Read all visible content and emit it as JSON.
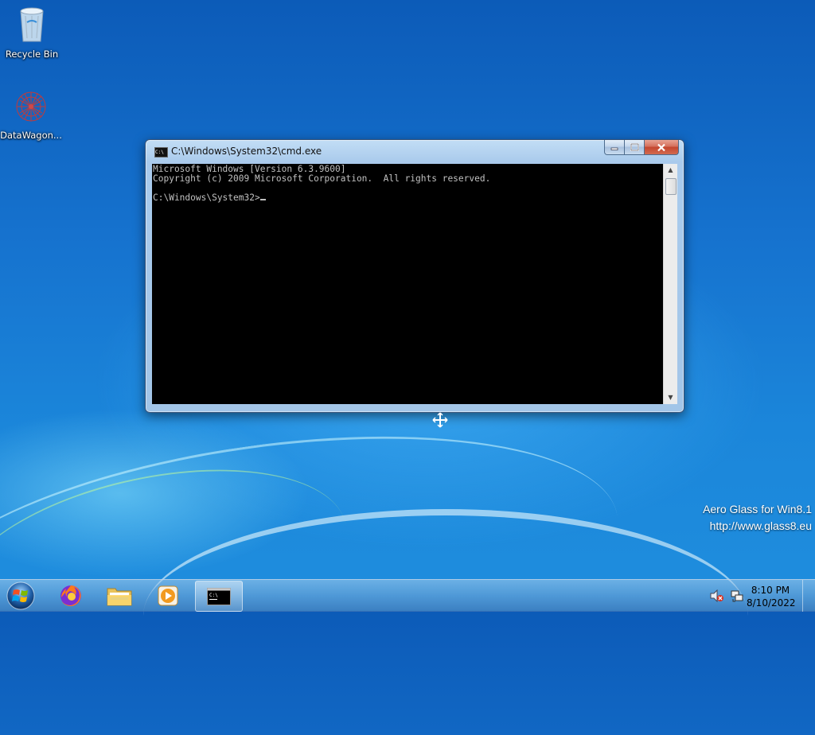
{
  "desktop": {
    "icons": [
      {
        "label": "Recycle Bin",
        "icon": "recycle-bin-icon"
      },
      {
        "label": "DataWagon...",
        "icon": "datawagon-icon"
      }
    ],
    "watermark": {
      "line1": "Aero Glass for Win8.1",
      "line2": "http://www.glass8.eu"
    }
  },
  "window": {
    "title": "C:\\Windows\\System32\\cmd.exe",
    "icon": "cmd-icon",
    "console": {
      "line1": "Microsoft Windows [Version 6.3.9600]",
      "line2": "Copyright (c) 2009 Microsoft Corporation.  All rights reserved.",
      "line3": "",
      "prompt": "C:\\Windows\\System32>"
    }
  },
  "taskbar": {
    "items": [
      {
        "name": "start-button",
        "icon": "windows-logo-icon"
      },
      {
        "name": "firefox",
        "icon": "firefox-icon"
      },
      {
        "name": "file-explorer",
        "icon": "folder-icon"
      },
      {
        "name": "media-player",
        "icon": "media-player-icon"
      },
      {
        "name": "cmd",
        "icon": "cmd-icon",
        "active": true
      }
    ],
    "tray": {
      "icons": [
        "volume-muted-icon",
        "network-icon"
      ],
      "time": "8:10 PM",
      "date": "8/10/2022"
    }
  },
  "colors": {
    "console_bg": "#000000",
    "console_fg": "#c0c0c0",
    "desktop_blue": "#1673cf"
  }
}
